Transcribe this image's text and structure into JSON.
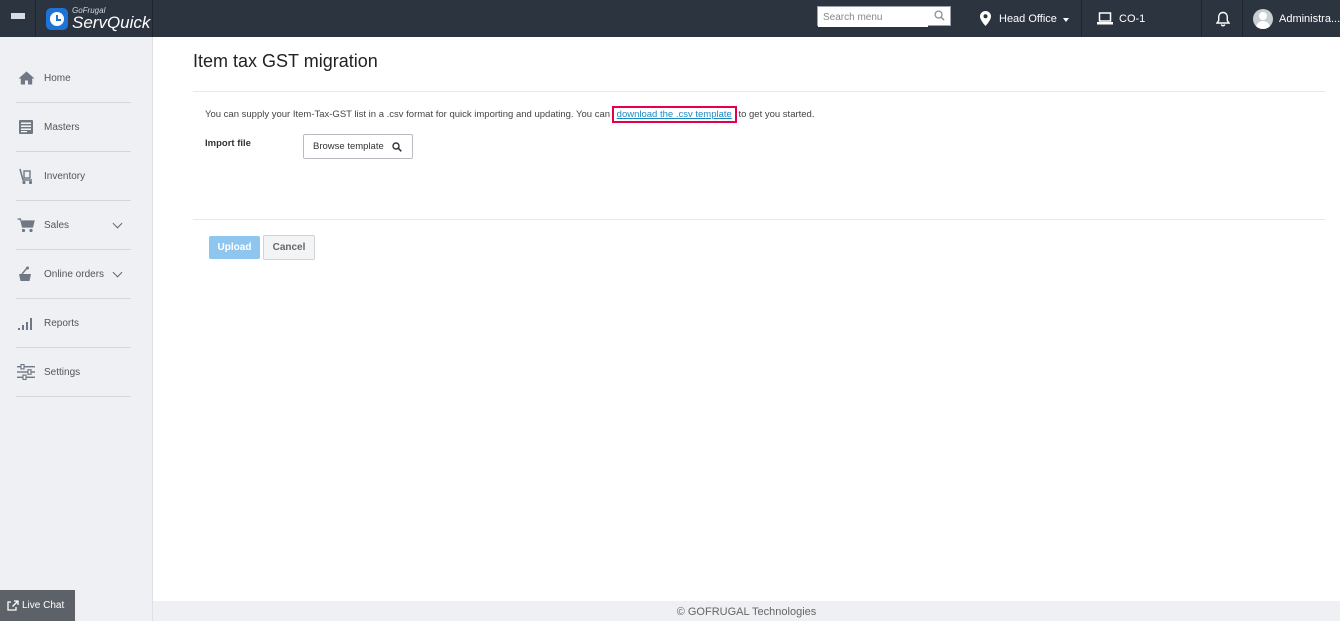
{
  "topbar": {
    "logo_small": "GoFrugal",
    "logo_big": "ServQuick",
    "search_placeholder": "Search menu",
    "location": "Head Office",
    "company": "CO-1",
    "user": "Administra..."
  },
  "sidebar": {
    "items": [
      {
        "label": "Home",
        "icon": "home-icon"
      },
      {
        "label": "Masters",
        "icon": "masters-icon"
      },
      {
        "label": "Inventory",
        "icon": "inventory-icon"
      },
      {
        "label": "Sales",
        "icon": "cart-icon"
      },
      {
        "label": "Online orders",
        "icon": "online-orders-icon"
      },
      {
        "label": "Reports",
        "icon": "reports-icon"
      },
      {
        "label": "Settings",
        "icon": "settings-icon"
      }
    ]
  },
  "main": {
    "title": "Item tax GST migration",
    "desc_before": "You can supply your Item-Tax-GST list in a .csv format for quick importing and updating. You can",
    "desc_link": "download the .csv template",
    "desc_after": "to get you started.",
    "import_label": "Import file",
    "browse_label": "Browse template",
    "upload_label": "Upload",
    "cancel_label": "Cancel"
  },
  "live_chat": "Live Chat",
  "footer": "© GOFRUGAL Technologies",
  "colors": {
    "topbar": "#2c3440",
    "upload": "#8ec6f0",
    "link": "#1a8ac6",
    "highlight": "#e4004f"
  }
}
